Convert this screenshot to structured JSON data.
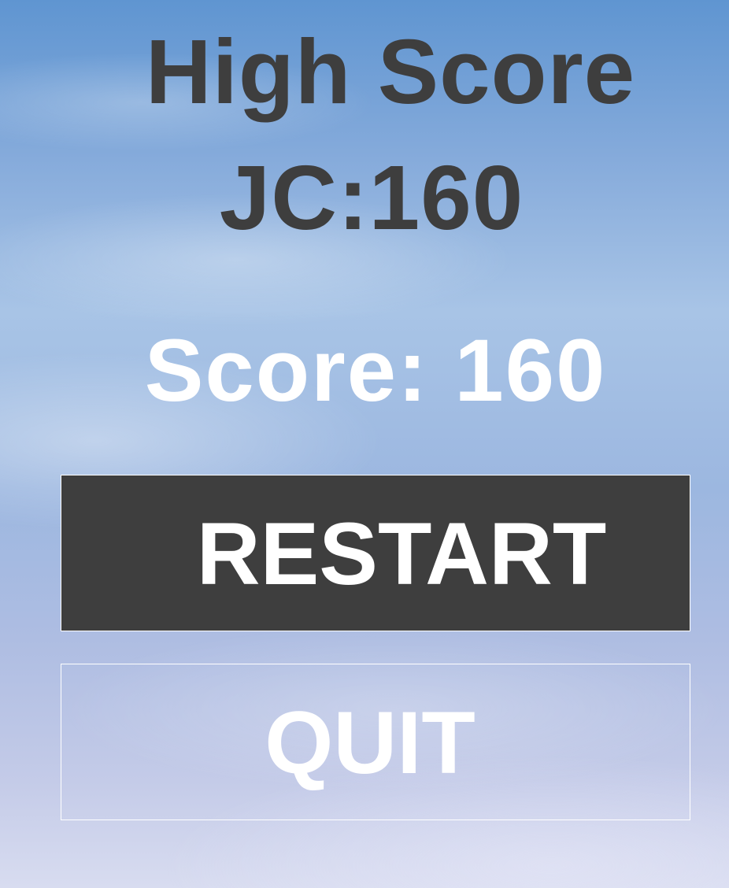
{
  "high_score": {
    "title": "High Score",
    "entry": "JC:160"
  },
  "current_score": {
    "label": "Score: 160"
  },
  "menu": {
    "restart_label": "RESTART",
    "quit_label": "QUIT"
  },
  "colors": {
    "dark_text": "#3e3e3e",
    "restart_bg": "#3e3e3e",
    "light_text": "#ffffff"
  }
}
